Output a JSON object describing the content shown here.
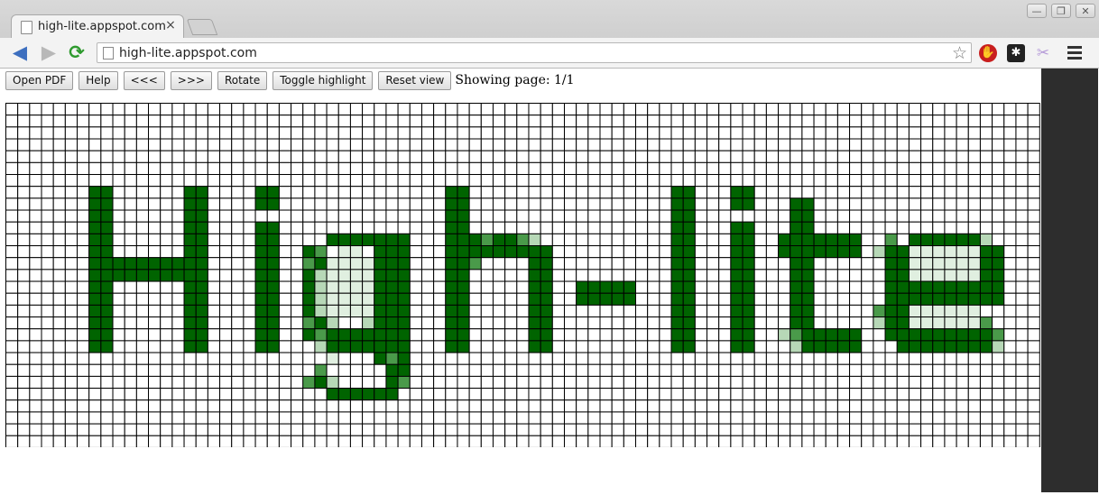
{
  "browser": {
    "tab_title": "high-lite.appspot.com",
    "tab_close": "×",
    "url": "high-lite.appspot.com",
    "window_buttons": [
      "—",
      "❐",
      "✕"
    ],
    "extension_icons": [
      "adblock-icon",
      "asterisk-extension-icon",
      "puzzle-extension-icon"
    ]
  },
  "toolbar": {
    "open_pdf": "Open PDF",
    "help": "Help",
    "prev": "<<<",
    "next": ">>>",
    "rotate": "Rotate",
    "toggle_highlight": "Toggle highlight",
    "reset_view": "Reset view",
    "page_status": "Showing page: 1/1"
  },
  "pixel_canvas": {
    "columns": 87,
    "rows": 29,
    "colors": {
      "grid_line": "#000000",
      "empty": "#ffffff",
      "full": "#006400",
      "medium": "#4a9a4a",
      "light": "#b7d8b7",
      "faint": "#e0efe0"
    },
    "highlighted_text": "High-lite"
  }
}
